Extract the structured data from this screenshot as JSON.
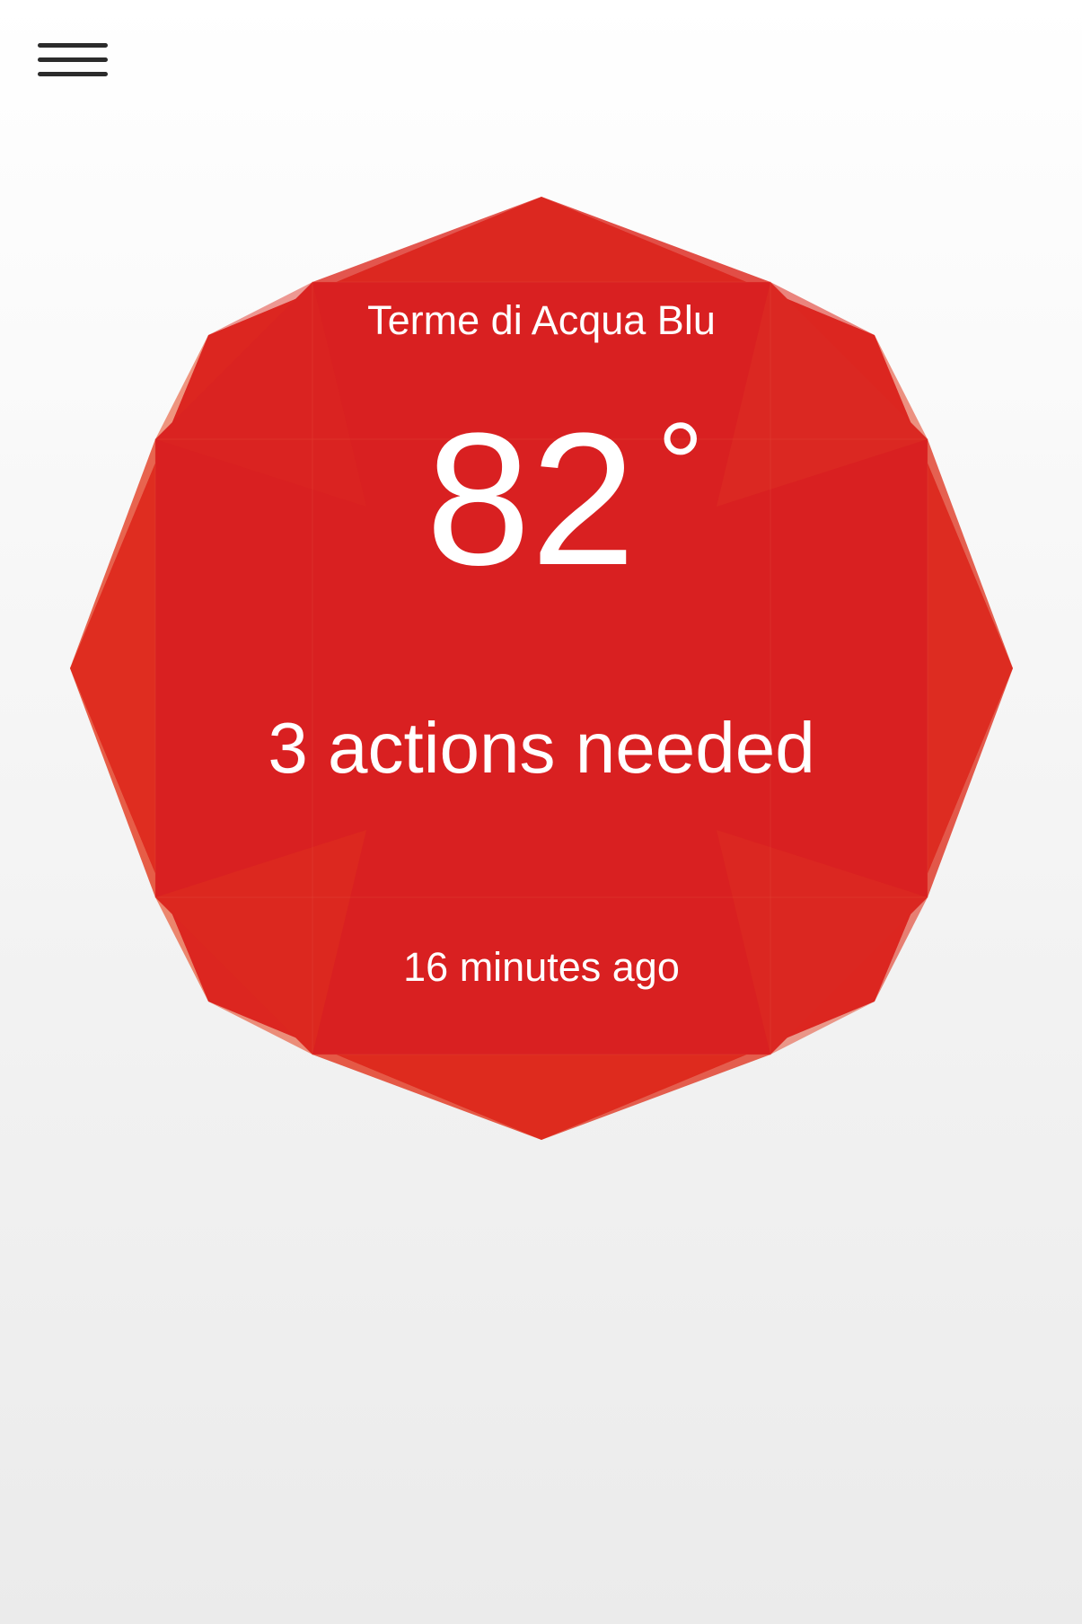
{
  "menu": {
    "icon": "hamburger-menu-icon"
  },
  "status": {
    "location": "Terme di Acqua Blu",
    "temperature": "82",
    "degree_symbol": "°",
    "actions": "3 actions needed",
    "updated": "16 minutes ago",
    "color": "#d92323",
    "shape": "octagon-gem"
  }
}
